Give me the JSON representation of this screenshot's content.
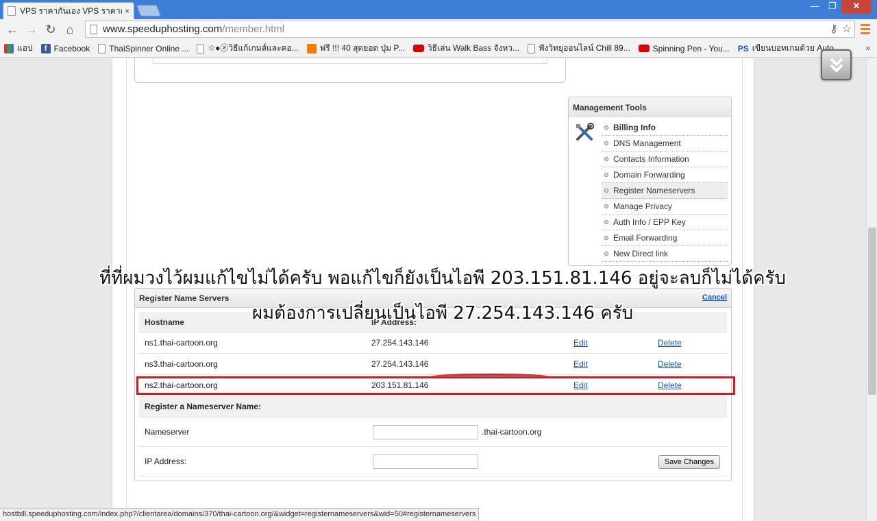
{
  "browser": {
    "tab_title": "VPS ราคากันเอง VPS ราคาถูก",
    "tab_close": "×",
    "url_host": "www.speeduphosting.com",
    "url_path": "/member.html",
    "window_controls": {
      "minimize": "—",
      "maximize": "❐",
      "close": "✕"
    },
    "nav": {
      "back": "←",
      "forward": "→",
      "reload": "↻",
      "home": "⌂"
    }
  },
  "bookmarks": {
    "items": [
      {
        "label": "แอป",
        "icon": "apps-icon"
      },
      {
        "label": "Facebook",
        "icon": "facebook-icon"
      },
      {
        "label": "ThaiSpinner Online ...",
        "icon": "page-icon"
      },
      {
        "label": "☆●ⓐวิธีแก้เกมส์และคอ...",
        "icon": "page-icon"
      },
      {
        "label": "ฟรี !!! 40 สุดยอด ปุ่ม P...",
        "icon": "blogger-icon"
      },
      {
        "label": "วิธีเล่น Walk Bass จังหว...",
        "icon": "youtube-icon"
      },
      {
        "label": "ฟังวิทยุออนไลน์ Chill 89...",
        "icon": "page-icon"
      },
      {
        "label": "Spinning Pen - You...",
        "icon": "youtube-icon"
      },
      {
        "label": "เขียนบอทเกมด้วย Auto...",
        "icon": "ps-icon"
      }
    ],
    "more": "»"
  },
  "management_tools": {
    "title": "Management Tools",
    "items": [
      {
        "label": "Billing Info"
      },
      {
        "label": "DNS Management"
      },
      {
        "label": "Contacts Information"
      },
      {
        "label": "Domain Forwarding"
      },
      {
        "label": "Register Nameservers"
      },
      {
        "label": "Manage Privacy"
      },
      {
        "label": "Auth Info / EPP Key"
      },
      {
        "label": "Email Forwarding"
      },
      {
        "label": "New Direct link"
      }
    ]
  },
  "register_name_servers": {
    "title": "Register Name Servers",
    "cancel": "Cancel",
    "headers": {
      "hostname": "Hostname",
      "ip": "IP Address:"
    },
    "rows": [
      {
        "hostname": "ns1.thai-cartoon.org",
        "ip": "27.254.143.146",
        "edit": "Edit",
        "delete": "Delete"
      },
      {
        "hostname": "ns3.thai-cartoon.org",
        "ip": "27.254.143.146",
        "edit": "Edit",
        "delete": "Delete"
      },
      {
        "hostname": "ns2.thai-cartoon.org",
        "ip": "203.151.81.146",
        "edit": "Edit",
        "delete": "Delete"
      }
    ],
    "form": {
      "section_title": "Register a Nameserver Name:",
      "nameserver_label": "Nameserver",
      "nameserver_value": "",
      "nameserver_suffix": ".thai-cartoon.org",
      "ip_label": "IP Address:",
      "ip_value": "",
      "save": "Save Changes"
    }
  },
  "overlay": {
    "line1": "ที่ที่ผมวงไว้ผมแก้ไขไม่ได้ครับ พอแก้ไขก็ยังเป็นไอพี 203.151.81.146 อยู่จะลบก็ไม่ได้ครับ",
    "line2": "ผมต้องการเปลี่ยนเป็นไอพี 27.254.143.146 ครับ"
  },
  "status_bar": "hostbill.speeduphosting.com/index.php?/clientarea/domains/370/thai-cartoon.org/&widget=registernameservers&wid=50#registernameservers",
  "colors": {
    "highlight": "#e0121a",
    "link": "#1155cc",
    "chrome_blue": "#3d7fd6"
  }
}
